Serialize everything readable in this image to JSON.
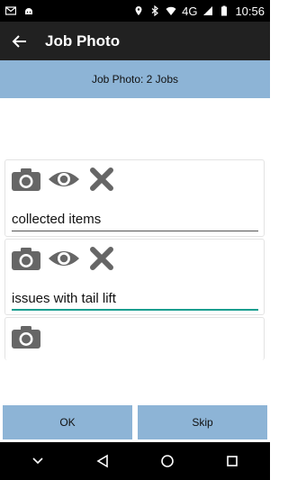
{
  "status_bar": {
    "icons_left": [
      "gmail-icon",
      "android-icon"
    ],
    "icons_right": [
      "location-icon",
      "bluetooth-icon",
      "wifi-icon"
    ],
    "network": "4G",
    "time": "10:56"
  },
  "app_bar": {
    "title": "Job Photo"
  },
  "banner": {
    "text": "Job Photo: 2 Jobs"
  },
  "jobs": [
    {
      "note": "collected items",
      "active": false
    },
    {
      "note": "issues with tail lift",
      "active": true
    },
    {
      "note": "",
      "active": false
    }
  ],
  "buttons": {
    "ok_label": "OK",
    "skip_label": "Skip"
  },
  "colors": {
    "app_bar_bg": "#212121",
    "accent_blue": "#8db4d6",
    "active_underline": "#179e8f",
    "icon_gray": "#666666"
  }
}
